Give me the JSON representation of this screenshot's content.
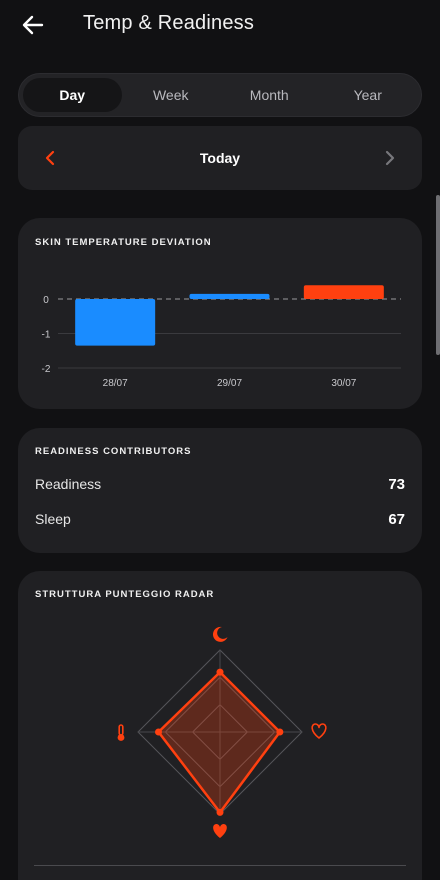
{
  "header": {
    "title": "Temp & Readiness"
  },
  "period_tabs": [
    {
      "label": "Day",
      "active": true
    },
    {
      "label": "Week",
      "active": false
    },
    {
      "label": "Month",
      "active": false
    },
    {
      "label": "Year",
      "active": false
    }
  ],
  "date_nav": {
    "label": "Today"
  },
  "colors": {
    "accent": "#ff4010",
    "blue": "#1a8cff",
    "card": "#202023",
    "background": "#111113"
  },
  "temperature_card": {
    "title": "SKIN TEMPERATURE DEVIATION",
    "chart_data": {
      "type": "bar",
      "categories": [
        "28/07",
        "29/07",
        "30/07"
      ],
      "values": [
        -1.35,
        0.15,
        0.4
      ],
      "bar_colors": [
        "#1a8cff",
        "#1a8cff",
        "#ff4010"
      ],
      "y_ticks": [
        "0",
        "-1",
        "-2"
      ],
      "ylim": [
        -2,
        0.5
      ],
      "baseline": "dashed at 0"
    }
  },
  "readiness_card": {
    "title": "READINESS CONTRIBUTORS",
    "rows": [
      {
        "label": "Readiness",
        "value": "73"
      },
      {
        "label": "Sleep",
        "value": "67"
      }
    ]
  },
  "radar_card": {
    "title": "STRUTTURA PUNTEGGIO RADAR",
    "chart_data": {
      "type": "radar",
      "axes": [
        {
          "icon": "moon-icon",
          "value": 0.73
        },
        {
          "icon": "heart-outline-icon",
          "value": 0.73
        },
        {
          "icon": "heart-icon",
          "value": 0.98
        },
        {
          "icon": "thermometer-icon",
          "value": 0.75
        }
      ],
      "rings": 3
    }
  }
}
